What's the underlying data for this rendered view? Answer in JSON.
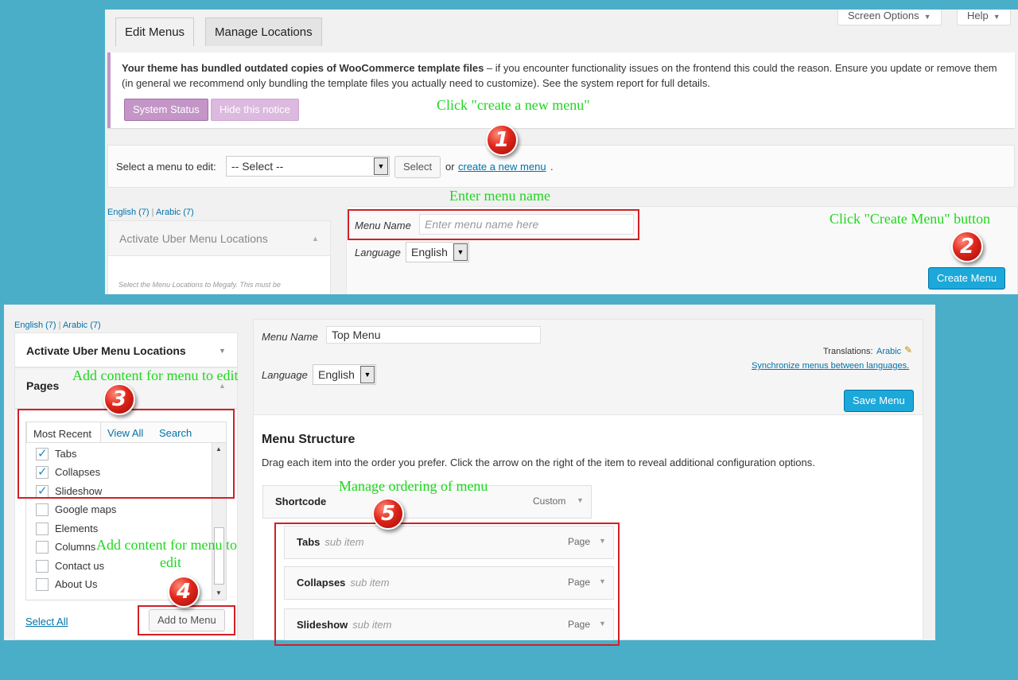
{
  "top": {
    "tabs": [
      "Edit Menus",
      "Manage Locations"
    ],
    "screen_options": "Screen Options",
    "help": "Help",
    "notice": {
      "bold": "Your theme has bundled outdated copies of WooCommerce template files",
      "text": " – if you encounter functionality issues on the frontend this could the reason. Ensure you update or remove them (in general we recommend only bundling the template files you actually need to customize). See the system report for full details.",
      "system_status": "System Status",
      "hide_notice": "Hide this notice"
    },
    "select_label": "Select a menu to edit:",
    "select_value": "-- Select --",
    "select_button": "Select",
    "or_text": "or",
    "create_link": "create a new menu",
    "period": ".",
    "lang_english": "English (7)",
    "lang_sep": "|",
    "lang_arabic": "Arabic (7)",
    "uber_title": "Activate Uber Menu Locations",
    "uber_desc": "Select the Menu Locations to Megafy. This must be",
    "menu_name_label": "Menu Name",
    "menu_name_placeholder": "Enter menu name here",
    "language_label": "Language",
    "language_value": "English",
    "create_menu_button": "Create Menu"
  },
  "bottom": {
    "lang_english": "English (7)",
    "lang_sep": "|",
    "lang_arabic": "Arabic (7)",
    "uber_title": "Activate Uber Menu Locations",
    "pages_title": "Pages",
    "tabs": [
      "Most Recent",
      "View All",
      "Search"
    ],
    "pages": [
      {
        "label": "Tabs",
        "checked": true
      },
      {
        "label": "Collapses",
        "checked": true
      },
      {
        "label": "Slideshow",
        "checked": true
      },
      {
        "label": "Google maps",
        "checked": false
      },
      {
        "label": "Elements",
        "checked": false
      },
      {
        "label": "Columns",
        "checked": false
      },
      {
        "label": "Contact us",
        "checked": false
      },
      {
        "label": "About Us",
        "checked": false
      }
    ],
    "select_all": "Select All",
    "add_to_menu": "Add to Menu",
    "menu_name_label": "Menu Name",
    "menu_name_value": "Top Menu",
    "translations_label": "Translations:",
    "translations_link": "Arabic",
    "sync_link": "Synchronize menus between languages.",
    "language_label": "Language",
    "language_value": "English",
    "save_menu": "Save Menu",
    "structure_title": "Menu Structure",
    "structure_desc": "Drag each item into the order you prefer. Click the arrow on the right of the item to reveal additional configuration options.",
    "items": [
      {
        "title": "Shortcode",
        "sub": "",
        "type": "Custom"
      },
      {
        "title": "Tabs",
        "sub": "sub item",
        "type": "Page"
      },
      {
        "title": "Collapses",
        "sub": "sub item",
        "type": "Page"
      },
      {
        "title": "Slideshow",
        "sub": "sub item",
        "type": "Page"
      }
    ]
  },
  "annotations": {
    "a1": "Click \"create a new menu\"",
    "a_name": "Enter menu name",
    "a2": "Click \"Create Menu\" button",
    "a3": "Add content for menu to edit",
    "a4_line1": "Add content for menu to",
    "a4_line2": "edit",
    "a5": "Manage ordering of menu",
    "badges": [
      "1",
      "2",
      "3",
      "4",
      "5"
    ]
  },
  "icons": [
    "pencil-icon",
    "triangle-up-icon",
    "triangle-down-icon",
    "select-arrow-icon",
    "scroll-up-icon",
    "scroll-down-icon",
    "checkbox-icon"
  ],
  "colors": {
    "background": "#4baec9",
    "primary_button": "#1ca8d9",
    "woo_purple": "#c396c7",
    "annotation_green": "#1fd61f",
    "annotation_red": "#d12027",
    "link": "#0073aa"
  }
}
